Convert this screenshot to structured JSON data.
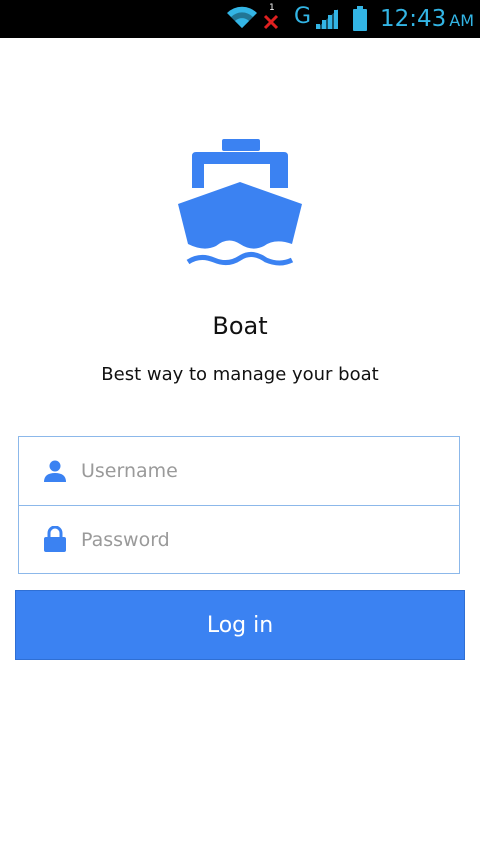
{
  "status_bar": {
    "sim_slot": "1",
    "network_type": "G",
    "time": "12:43",
    "ampm": "AM",
    "accent_color": "#33b5e5"
  },
  "app": {
    "logo_icon": "ship-icon",
    "title": "Boat",
    "tagline": "Best way to manage your boat",
    "brand_color": "#3b82f2"
  },
  "form": {
    "username": {
      "icon": "user-icon",
      "placeholder": "Username",
      "value": ""
    },
    "password": {
      "icon": "lock-icon",
      "placeholder": "Password",
      "value": ""
    },
    "login_label": "Log in"
  }
}
